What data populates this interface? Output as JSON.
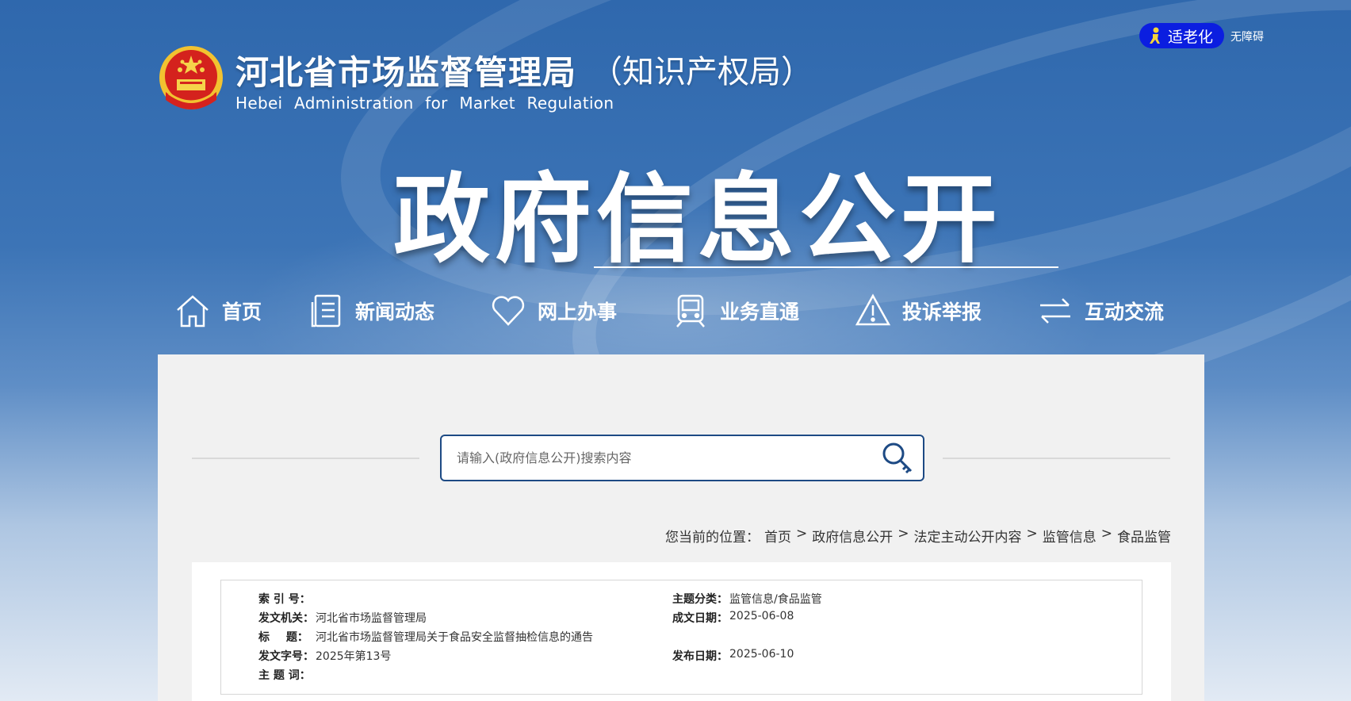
{
  "header": {
    "title_cn": "河北省市场监督管理局",
    "title_sub": "（知识产权局）",
    "title_en": "Hebei Administration for Market Regulation",
    "elder_mode_label": "适老化",
    "accessibility_label": "无障碍"
  },
  "banner": {
    "title": "政府信息公开"
  },
  "nav": {
    "items": [
      {
        "label": "首页",
        "icon": "home-icon"
      },
      {
        "label": "新闻动态",
        "icon": "news-icon"
      },
      {
        "label": "网上办事",
        "icon": "heart-icon"
      },
      {
        "label": "业务直通",
        "icon": "train-icon"
      },
      {
        "label": "投诉举报",
        "icon": "warning-icon"
      },
      {
        "label": "互动交流",
        "icon": "exchange-icon"
      }
    ]
  },
  "search": {
    "placeholder": "请输入(政府信息公开)搜索内容",
    "value": ""
  },
  "breadcrumb": {
    "prefix": "您当前的位置：",
    "items": [
      "首页",
      "政府信息公开",
      "法定主动公开内容",
      "监管信息",
      "食品监管"
    ],
    "separator": ">"
  },
  "document_info": {
    "index_label": "索 引 号：",
    "index_value": "",
    "topic_label": "主题分类：",
    "topic_value": "监管信息/食品监管",
    "issuer_label": "发文机关：",
    "issuer_value": "河北省市场监督管理局",
    "created_label": "成文日期：",
    "created_value": "2025-06-08",
    "title_label": "标 题：",
    "title_value": "河北省市场监督管理局关于食品安全监督抽检信息的通告",
    "doc_no_label": "发文字号：",
    "doc_no_value": "2025年第13号",
    "publish_label": "发布日期：",
    "publish_value": "2025-06-10",
    "keywords_label": "主 题 词：",
    "keywords_value": ""
  },
  "colors": {
    "banner_top": "#2f68ad",
    "elder_button": "#0b1ee0",
    "search_border": "#1d4a84",
    "panel_bg": "#f1f1f1"
  }
}
